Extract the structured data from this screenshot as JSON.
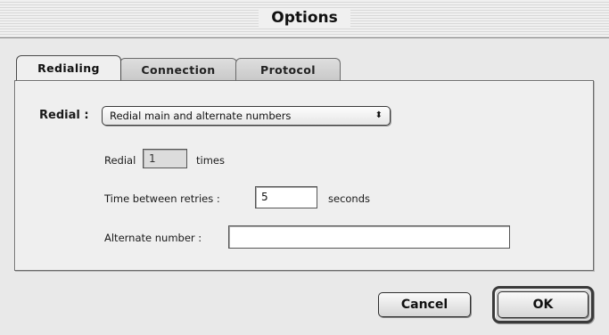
{
  "window": {
    "title": "Options"
  },
  "tabs": [
    {
      "label": "Redialing",
      "active": true
    },
    {
      "label": "Connection",
      "active": false
    },
    {
      "label": "Protocol",
      "active": false
    }
  ],
  "redialing": {
    "redial_label": "Redial :",
    "redial_popup_value": "Redial main and alternate numbers",
    "redial_count_prefix": "Redial",
    "redial_count_value": "1",
    "redial_count_suffix": "times",
    "time_between_label": "Time between retries :",
    "time_between_value": "5",
    "time_between_unit": "seconds",
    "alternate_number_label": "Alternate number :",
    "alternate_number_value": ""
  },
  "buttons": {
    "cancel_label": "Cancel",
    "ok_label": "OK"
  }
}
